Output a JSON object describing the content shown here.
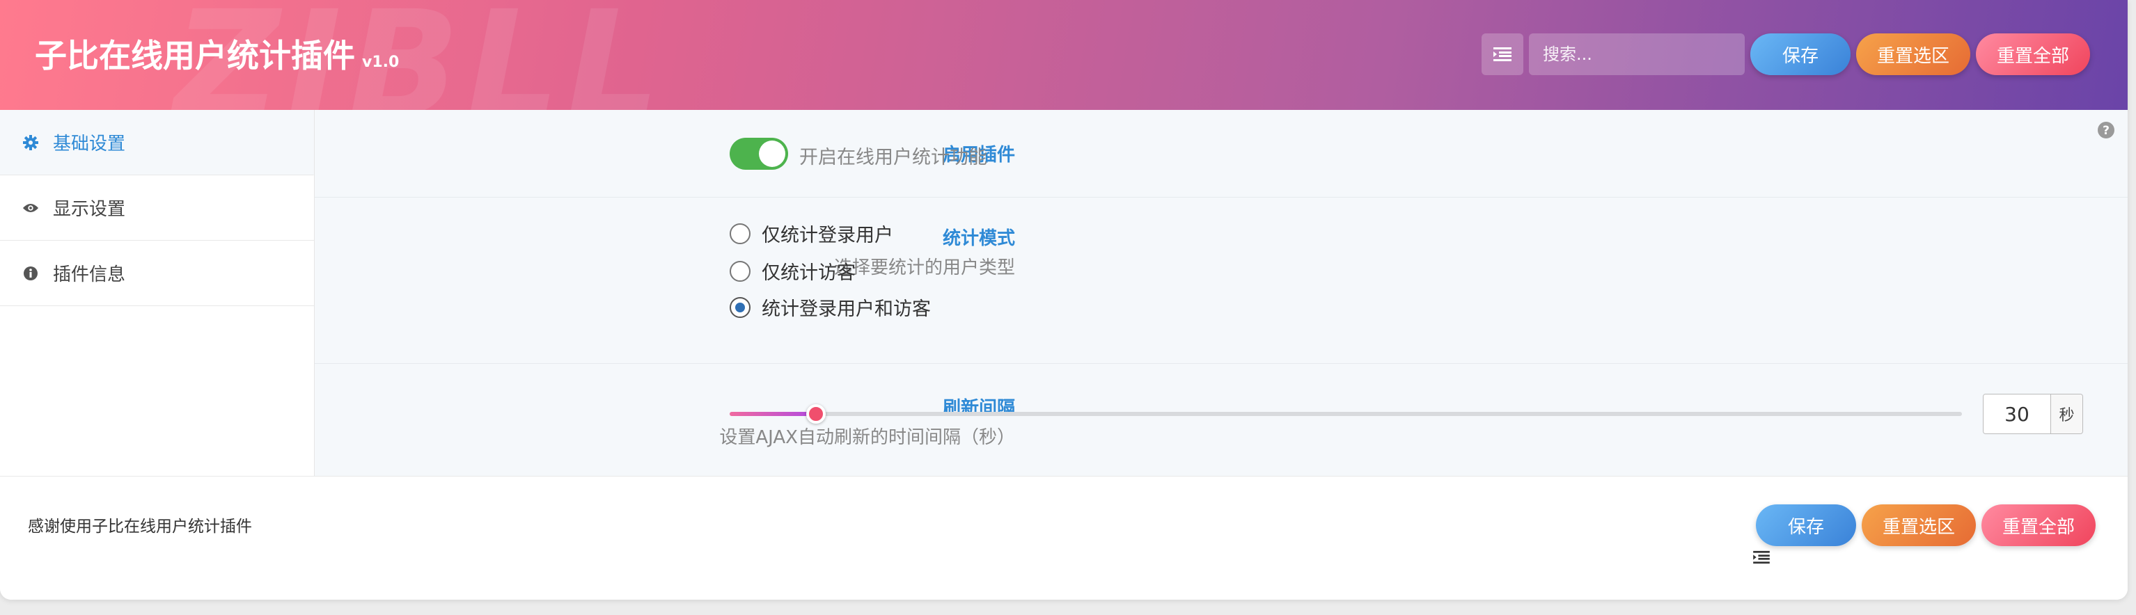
{
  "header": {
    "title": "子比在线用户统计插件",
    "version": "v1.0",
    "watermark": "ZIBLL",
    "search_placeholder": "搜索...",
    "save_label": "保存",
    "reset_section_label": "重置选区",
    "reset_all_label": "重置全部"
  },
  "sidebar": {
    "items": [
      {
        "label": "基础设置",
        "icon": "gear-icon",
        "active": true
      },
      {
        "label": "显示设置",
        "icon": "eye-icon",
        "active": false
      },
      {
        "label": "插件信息",
        "icon": "info-icon",
        "active": false
      }
    ]
  },
  "settings": {
    "enable": {
      "label": "启用插件",
      "description": "开启在线用户统计功能",
      "enabled": true
    },
    "mode": {
      "label": "统计模式",
      "sublabel": "选择要统计的用户类型",
      "options": [
        "仅统计登录用户",
        "仅统计访客",
        "统计登录用户和访客"
      ],
      "selected": "统计登录用户和访客"
    },
    "interval": {
      "label": "刷新间隔",
      "sublabel": "设置AJAX自动刷新的时间间隔（秒）",
      "value": "30",
      "unit": "秒",
      "fill_fraction": 0.07
    }
  },
  "footer": {
    "text": "感谢使用子比在线用户统计插件",
    "save_label": "保存",
    "reset_section_label": "重置选区",
    "reset_all_label": "重置全部"
  },
  "colors": {
    "accent": "#2f8ad6",
    "toggle_on": "#4db34d",
    "slider_knob": "#f04f6d"
  }
}
